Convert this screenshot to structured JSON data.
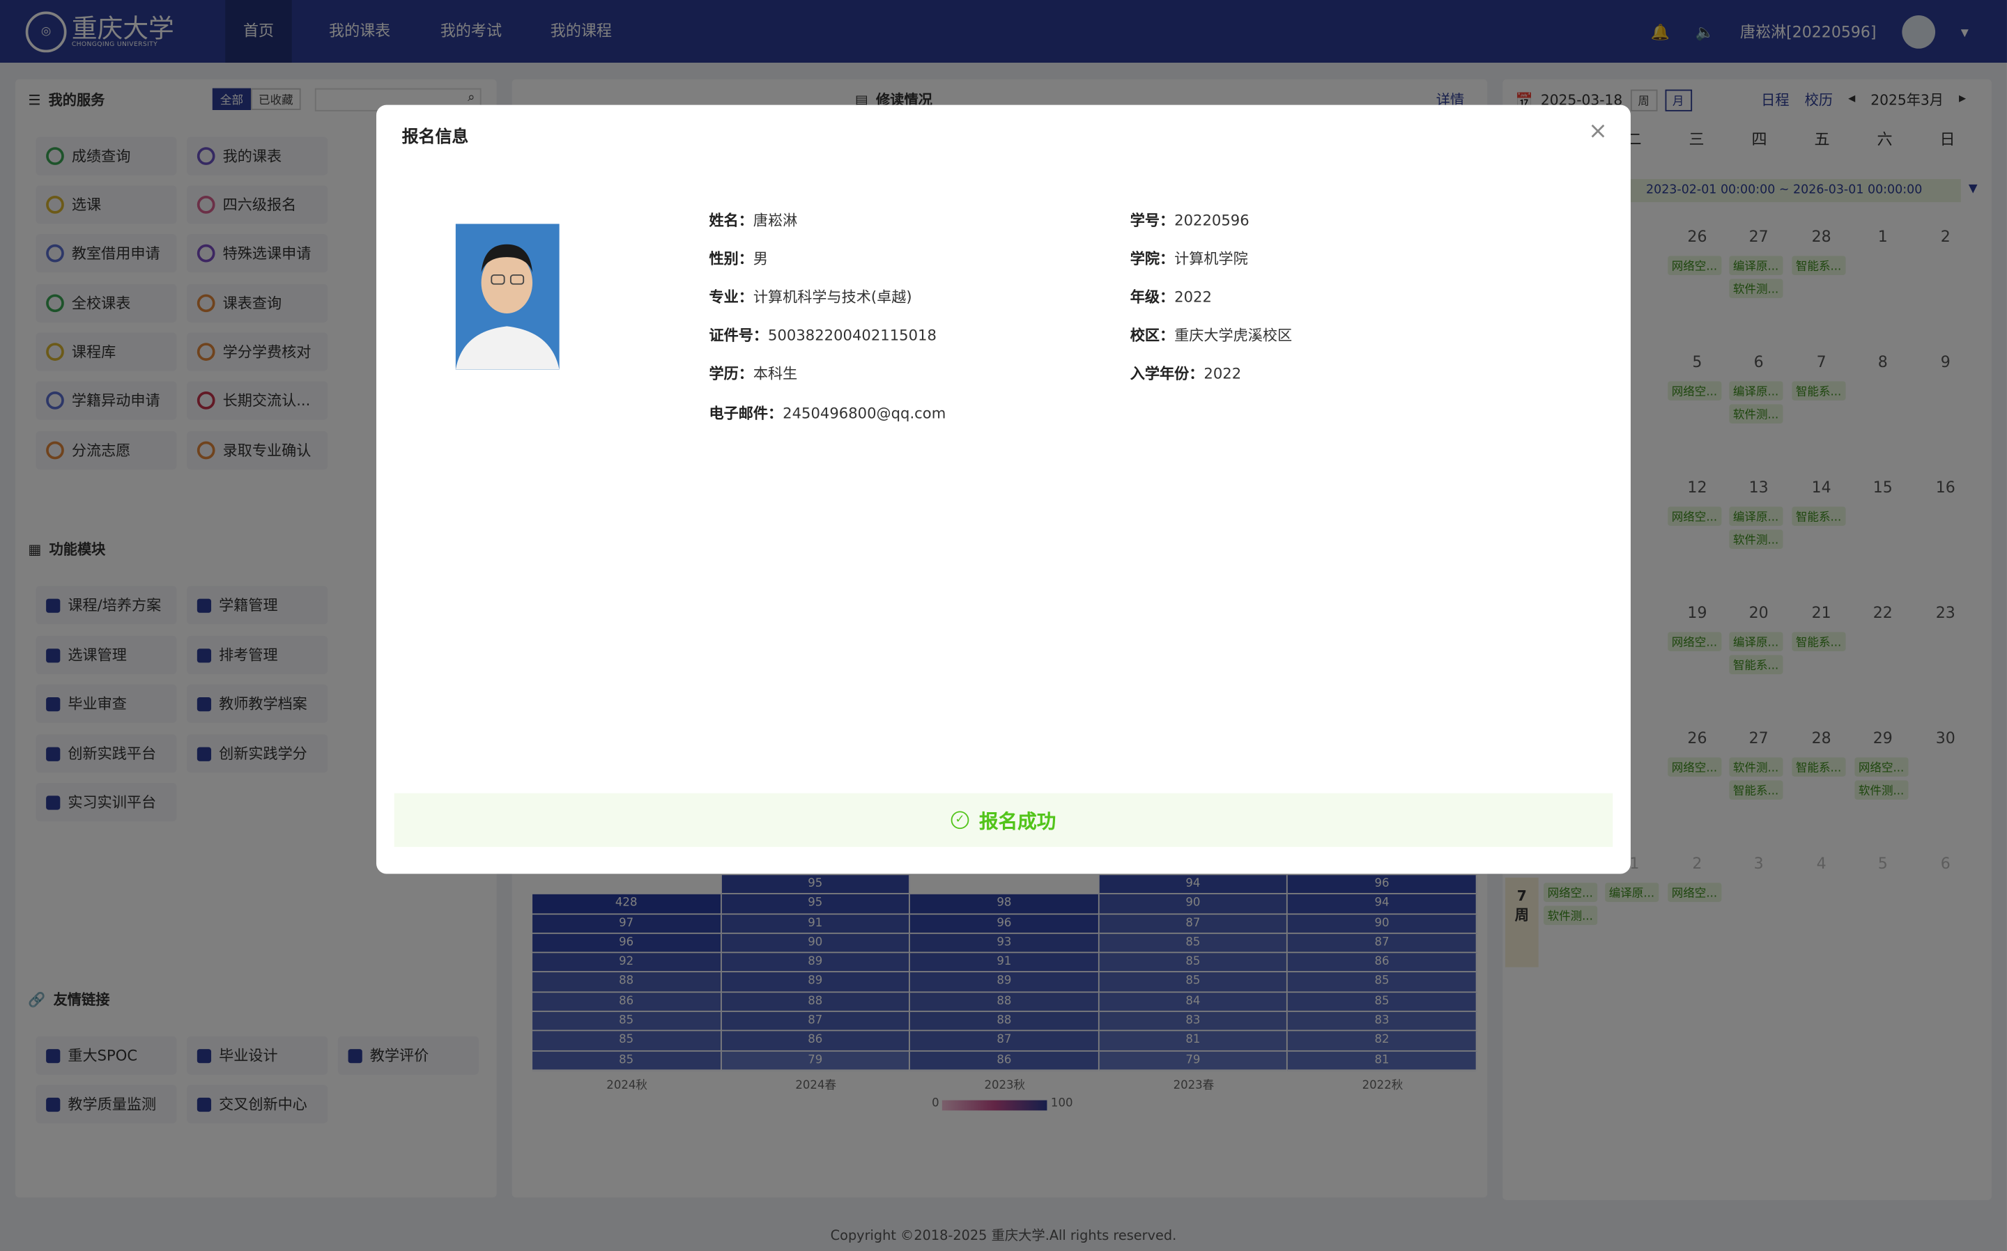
{
  "nav": {
    "logo": "重庆大学",
    "logo_sub": "CHONGQING UNIVERSITY",
    "tabs": [
      "首页",
      "我的课表",
      "我的考试",
      "我的课程"
    ],
    "user": "唐崧淋[20220596]"
  },
  "services": {
    "title": "我的服务",
    "filter_all": "全部",
    "filter_fav": "已收藏",
    "col1": [
      "成绩查询",
      "选课",
      "教室借用申请",
      "全校课表",
      "课程库",
      "学籍异动申请",
      "分流志愿"
    ],
    "col2": [
      "我的课表",
      "四六级报名",
      "特殊选课申请",
      "课表查询",
      "学分学费核对",
      "长期交流认...",
      "录取专业确认"
    ]
  },
  "modules": {
    "title": "功能模块",
    "col1": [
      "课程/培养方案",
      "选课管理",
      "毕业审查",
      "创新实践平台",
      "实习实训平台"
    ],
    "col2": [
      "学籍管理",
      "排考管理",
      "教师教学档案",
      "创新实践学分"
    ]
  },
  "links": {
    "title": "友情链接",
    "items": [
      "重大SPOC",
      "毕业设计",
      "教学评价",
      "教学质量监测",
      "交叉创新中心"
    ]
  },
  "progress": {
    "title": "修读情况",
    "detail": "详情"
  },
  "heatmap": {
    "rows": [
      [
        "",
        "95",
        "",
        "94",
        "96"
      ],
      [
        "428",
        "95",
        "98",
        "90",
        "94"
      ],
      [
        "97",
        "91",
        "96",
        "87",
        "90"
      ],
      [
        "96",
        "90",
        "93",
        "85",
        "87"
      ],
      [
        "92",
        "89",
        "91",
        "85",
        "86"
      ],
      [
        "88",
        "89",
        "89",
        "85",
        "85"
      ],
      [
        "86",
        "88",
        "88",
        "84",
        "85"
      ],
      [
        "85",
        "87",
        "88",
        "83",
        "83"
      ],
      [
        "85",
        "86",
        "87",
        "81",
        "82"
      ],
      [
        "85",
        "79",
        "86",
        "79",
        "81"
      ]
    ],
    "xlabels": [
      "2024秋",
      "2024春",
      "2023秋",
      "2023春",
      "2022秋"
    ],
    "scale_min": "0",
    "scale_max": "100"
  },
  "calendar": {
    "date": "2025-03-18",
    "view_week": "周",
    "view_month": "月",
    "schedule": "日程",
    "school_cal": "校历",
    "month": "2025年3月",
    "weekdays": [
      "二",
      "三",
      "四",
      "五",
      "六",
      "日"
    ],
    "range": "2023-02-01 00:00:00 ~ 2026-03-01 00:00:00",
    "week_label": "7",
    "week_unit": "周"
  },
  "modal": {
    "title": "报名信息",
    "close": "×",
    "name_label": "姓名：",
    "name": "唐崧淋",
    "sid_label": "学号：",
    "sid": "20220596",
    "gender_label": "性别：",
    "gender": "男",
    "college_label": "学院：",
    "college": "计算机学院",
    "major_label": "专业：",
    "major": "计算机科学与技术(卓越)",
    "grade_label": "年级：",
    "grade": "2022",
    "id_label": "证件号：",
    "id": "500382200402115018",
    "campus_label": "校区：",
    "campus": "重庆大学虎溪校区",
    "edu_label": "学历：",
    "edu": "本科生",
    "year_label": "入学年份：",
    "year": "2022",
    "email_label": "电子邮件：",
    "email": "2450496800@qq.com",
    "success": "报名成功"
  },
  "footer": "Copyright ©2018-2025 重庆大学.All rights reserved."
}
